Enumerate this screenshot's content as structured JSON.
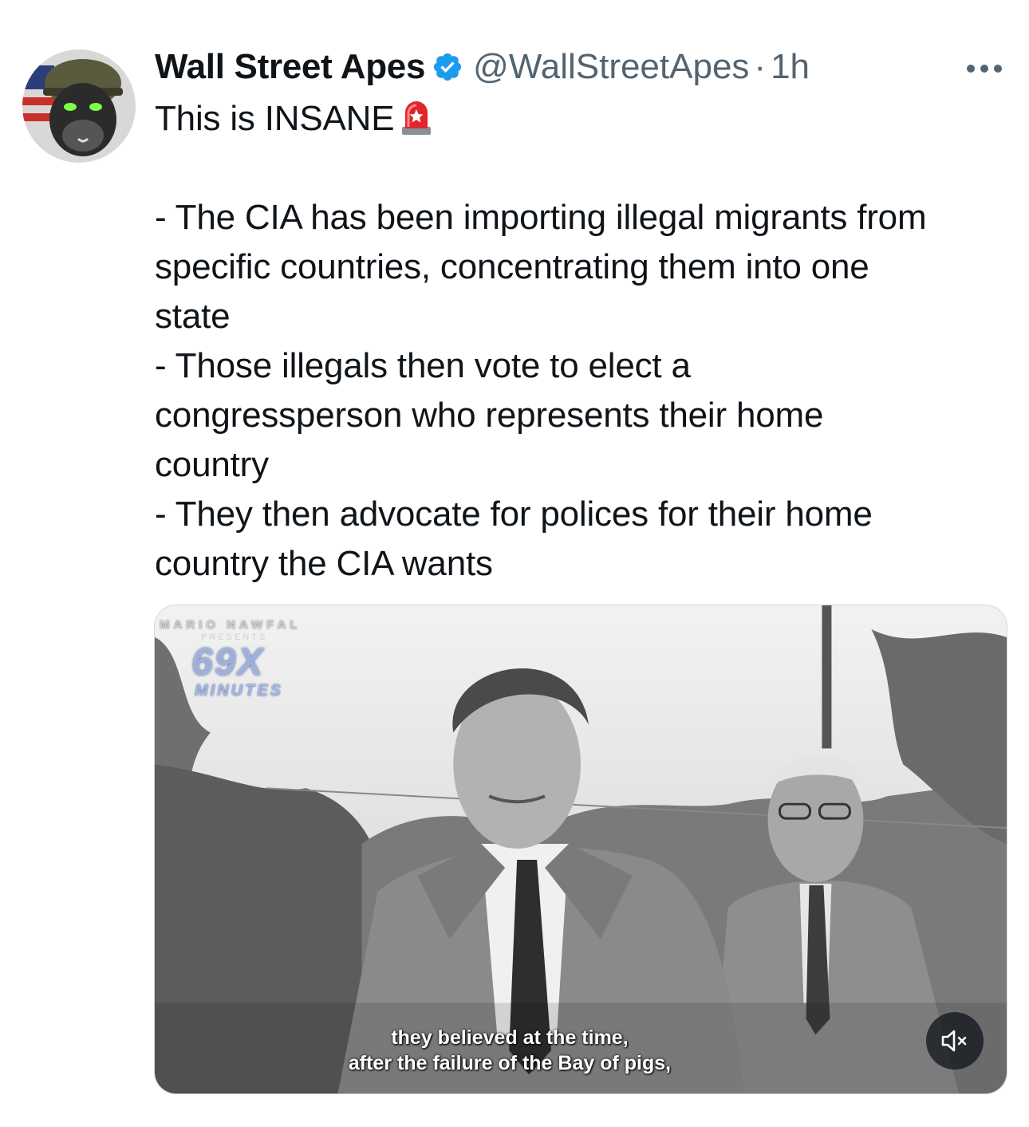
{
  "author": {
    "display_name": "Wall Street Apes",
    "handle": "@WallStreetApes",
    "separator": "·",
    "time": "1h",
    "verified": true,
    "verified_color": "#1d9bf0"
  },
  "tweet": {
    "lines": [
      "This is INSANE",
      "",
      "- The CIA has been importing illegal migrants from",
      "specific countries, concentrating them into one",
      "state",
      "- Those illegals then vote to elect a",
      "congressperson who represents their home",
      "country",
      "- They then advocate for polices for their home",
      "country the CIA wants"
    ],
    "emoji": "siren-icon"
  },
  "media": {
    "type": "video",
    "watermark_brand": "MARIO NAWFAL",
    "watermark_sub": "PRESENTS",
    "watermark_title": "69X",
    "watermark_subtitle": "MINUTES",
    "caption_line_1": "they believed at the time,",
    "caption_line_2": "after the failure of the Bay of pigs,",
    "muted": true
  },
  "icons": {
    "more": "more-horizontal-icon",
    "mute": "volume-muted-icon",
    "verified": "verified-badge-icon"
  }
}
